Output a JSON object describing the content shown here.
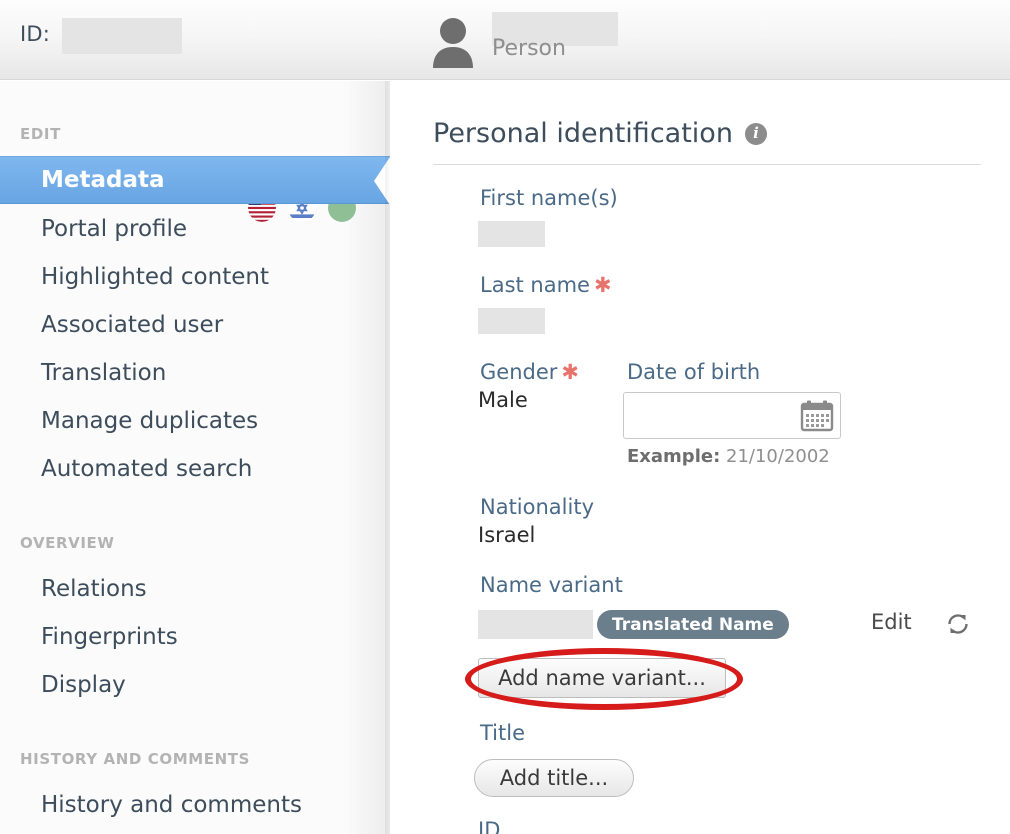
{
  "header": {
    "id_label": "ID:",
    "id_value_redacted": "",
    "person_name_redacted": "",
    "person_type": "Person",
    "avatar_icon": "person-avatar-icon"
  },
  "sidebar": {
    "sections": [
      {
        "heading": "EDIT",
        "items": [
          {
            "label": "Metadata",
            "active": true
          },
          {
            "label": "Portal profile",
            "active": false
          },
          {
            "label": "Highlighted content",
            "active": false
          },
          {
            "label": "Associated user",
            "active": false
          },
          {
            "label": "Translation",
            "active": false
          },
          {
            "label": "Manage duplicates",
            "active": false
          },
          {
            "label": "Automated search",
            "active": false
          }
        ]
      },
      {
        "heading": "OVERVIEW",
        "items": [
          {
            "label": "Relations",
            "active": false
          },
          {
            "label": "Fingerprints",
            "active": false
          },
          {
            "label": "Display",
            "active": false
          }
        ]
      },
      {
        "heading": "HISTORY AND COMMENTS",
        "items": [
          {
            "label": "History and comments",
            "active": false
          }
        ]
      }
    ],
    "language_icons": [
      {
        "name": "flag-us-icon",
        "title": "English"
      },
      {
        "name": "flag-israel-icon",
        "title": "Hebrew"
      },
      {
        "name": "status-green-circle-icon",
        "title": ""
      }
    ],
    "active_color": "#68a5e3",
    "heading_color": "#b3b3b3",
    "item_color": "#3d4d5c"
  },
  "main": {
    "panel_title": "Personal identification",
    "info_icon_glyph": "i",
    "fields": {
      "first_name": {
        "label": "First name(s)",
        "value_redacted": "",
        "required": false
      },
      "last_name": {
        "label": "Last name",
        "value_redacted": "",
        "required": true,
        "star": "✱"
      },
      "gender": {
        "label": "Gender",
        "value": "Male",
        "required": true,
        "star": "✱"
      },
      "date_of_birth": {
        "label": "Date of birth",
        "value": "",
        "placeholder": "",
        "example_prefix": "Example:",
        "example_value": "21/10/2002",
        "calendar_icon": "calendar-icon"
      },
      "nationality": {
        "label": "Nationality",
        "value": "Israel"
      },
      "name_variant": {
        "label": "Name variant",
        "value_redacted": "",
        "badge": "Translated Name",
        "edit_link": "Edit",
        "refresh_icon": "refresh-icon",
        "badge_color": "#6b7e8c"
      },
      "title": {
        "label": "Title"
      },
      "id": {
        "label": "ID"
      }
    },
    "buttons": {
      "add_name_variant": "Add name variant...",
      "add_title": "Add title..."
    },
    "annotation": {
      "type": "ellipse",
      "color": "#d61b1b",
      "target": "Add name variant..."
    },
    "label_color": "#4a6a87",
    "required_color": "#e8736c"
  }
}
